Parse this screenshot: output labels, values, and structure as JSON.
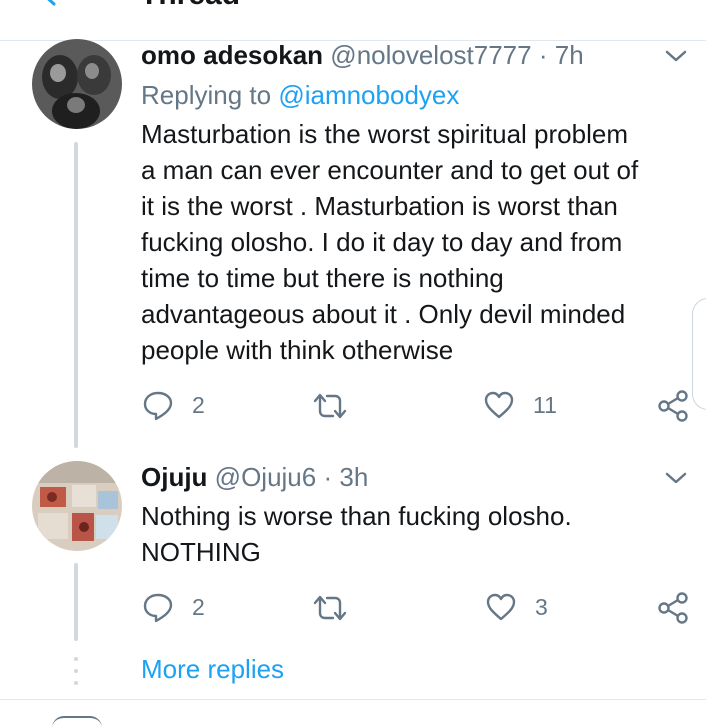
{
  "header": {
    "title": "Thread"
  },
  "tweets": [
    {
      "name": "omo adesokan",
      "handle": "@nolovelost7777",
      "dot": "·",
      "time": "7h",
      "replying_prefix": "Replying to",
      "replying_to": "@iamnobodyex",
      "text_lines": [
        "Masturbation is the worst spiritual problem",
        "a man can ever encounter and to get out of",
        "it is the worst . Masturbation is worst than",
        "fucking olosho. I do it day to day and from",
        "time to time but there is nothing",
        "advantageous about it . Only devil minded",
        "people with think otherwise"
      ],
      "replies": "2",
      "retweets": "",
      "likes": "11"
    },
    {
      "name": "Ojuju",
      "handle": "@Ojuju6",
      "dot": "·",
      "time": "3h",
      "text_lines": [
        "Nothing is worse than fucking olosho.",
        "NOTHING"
      ],
      "replies": "2",
      "retweets": "",
      "likes": "3"
    }
  ],
  "more_replies": "More replies",
  "colors": {
    "accent": "#1da1f2",
    "secondary_text": "#657786",
    "thread_line": "#cfd9de"
  },
  "icons": [
    "back-arrow-icon",
    "chevron-down-icon",
    "reply-icon",
    "retweet-icon",
    "like-icon",
    "share-icon"
  ]
}
